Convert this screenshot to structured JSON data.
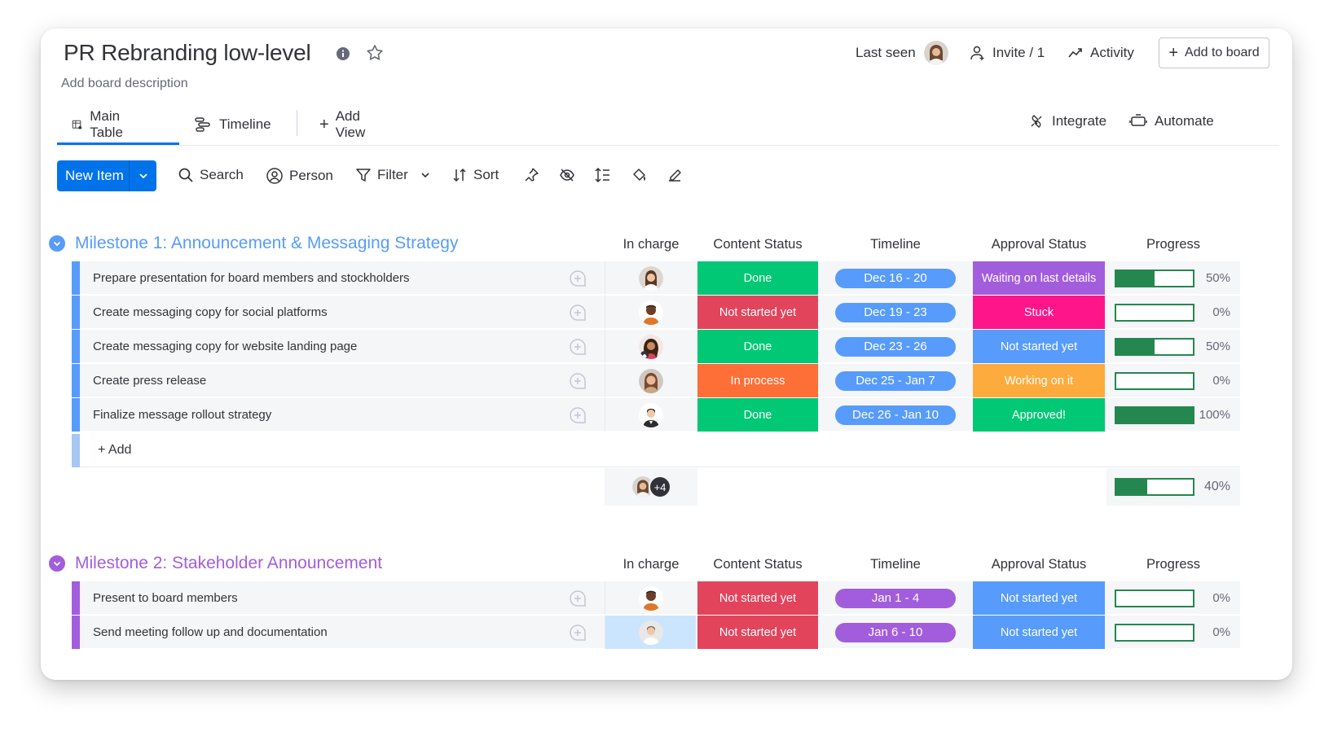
{
  "header": {
    "board_title": "PR Rebranding low-level",
    "board_description": "Add board description",
    "last_seen_label": "Last seen",
    "invite_label": "Invite / 1",
    "activity_label": "Activity",
    "add_to_board_label": "Add to board"
  },
  "views": {
    "tabs": [
      {
        "label": "Main Table",
        "active": true
      },
      {
        "label": "Timeline",
        "active": false
      }
    ],
    "add_view_label": "Add View",
    "integrate_label": "Integrate",
    "automate_label": "Automate"
  },
  "toolbar": {
    "new_item_label": "New Item",
    "search_label": "Search",
    "person_label": "Person",
    "filter_label": "Filter",
    "sort_label": "Sort"
  },
  "columns": {
    "in_charge": "In charge",
    "content_status": "Content Status",
    "timeline": "Timeline",
    "approval_status": "Approval Status",
    "progress": "Progress"
  },
  "colors": {
    "primary": "#0073ea",
    "done": "#00c875",
    "not_started_red": "#e2445c",
    "in_process": "#fd6f36",
    "working_on_it": "#fdab3d",
    "stuck": "#ff158a",
    "waiting": "#a25ddc",
    "not_started_blue": "#579bfc",
    "group1": "#579bfc",
    "group2": "#a25ddc",
    "progress_green": "#258750"
  },
  "groups": [
    {
      "title": "Milestone 1: Announcement & Messaging Strategy",
      "color": "#579bfc",
      "items": [
        {
          "name": "Prepare presentation for board members and stockholders",
          "content_status": "Done",
          "content_color": "#00c875",
          "timeline": "Dec 16 - 20",
          "timeline_color": "#579bfc",
          "approval": "Waiting on last details",
          "approval_color": "#a25ddc",
          "progress": 0.5,
          "progress_label": "50%"
        },
        {
          "name": "Create messaging copy for social platforms",
          "content_status": "Not started yet",
          "content_color": "#e2445c",
          "timeline": "Dec 19 - 23",
          "timeline_color": "#579bfc",
          "approval": "Stuck",
          "approval_color": "#ff158a",
          "progress": 0.0,
          "progress_label": "0%"
        },
        {
          "name": "Create messaging copy for website landing page",
          "content_status": "Done",
          "content_color": "#00c875",
          "timeline": "Dec 23 - 26",
          "timeline_color": "#579bfc",
          "approval": "Not started yet",
          "approval_color": "#579bfc",
          "progress": 0.5,
          "progress_label": "50%"
        },
        {
          "name": "Create press release",
          "content_status": "In process",
          "content_color": "#fd6f36",
          "timeline": "Dec 25 - Jan 7",
          "timeline_color": "#579bfc",
          "approval": "Working on it",
          "approval_color": "#fdab3d",
          "progress": 0.0,
          "progress_label": "0%"
        },
        {
          "name": "Finalize message rollout strategy",
          "content_status": "Done",
          "content_color": "#00c875",
          "timeline": "Dec 26 - Jan 10",
          "timeline_color": "#579bfc",
          "approval": "Approved!",
          "approval_color": "#00c875",
          "progress": 1.0,
          "progress_label": "100%"
        }
      ],
      "add_label": "+ Add",
      "summary": {
        "extra_people": "+4",
        "progress": 0.4,
        "progress_label": "40%"
      }
    },
    {
      "title": "Milestone 2: Stakeholder Announcement",
      "color": "#a25ddc",
      "items": [
        {
          "name": "Present to board members",
          "content_status": "Not started yet",
          "content_color": "#e2445c",
          "timeline": "Jan 1 - 4",
          "timeline_color": "#a25ddc",
          "approval": "Not started yet",
          "approval_color": "#579bfc",
          "progress": 0.0,
          "progress_label": "0%"
        },
        {
          "name": "Send meeting follow up and documentation",
          "content_status": "Not started yet",
          "content_color": "#e2445c",
          "timeline": "Jan 6 - 10",
          "timeline_color": "#a25ddc",
          "approval": "Not started yet",
          "approval_color": "#579bfc",
          "progress": 0.0,
          "progress_label": "0%"
        }
      ]
    }
  ]
}
